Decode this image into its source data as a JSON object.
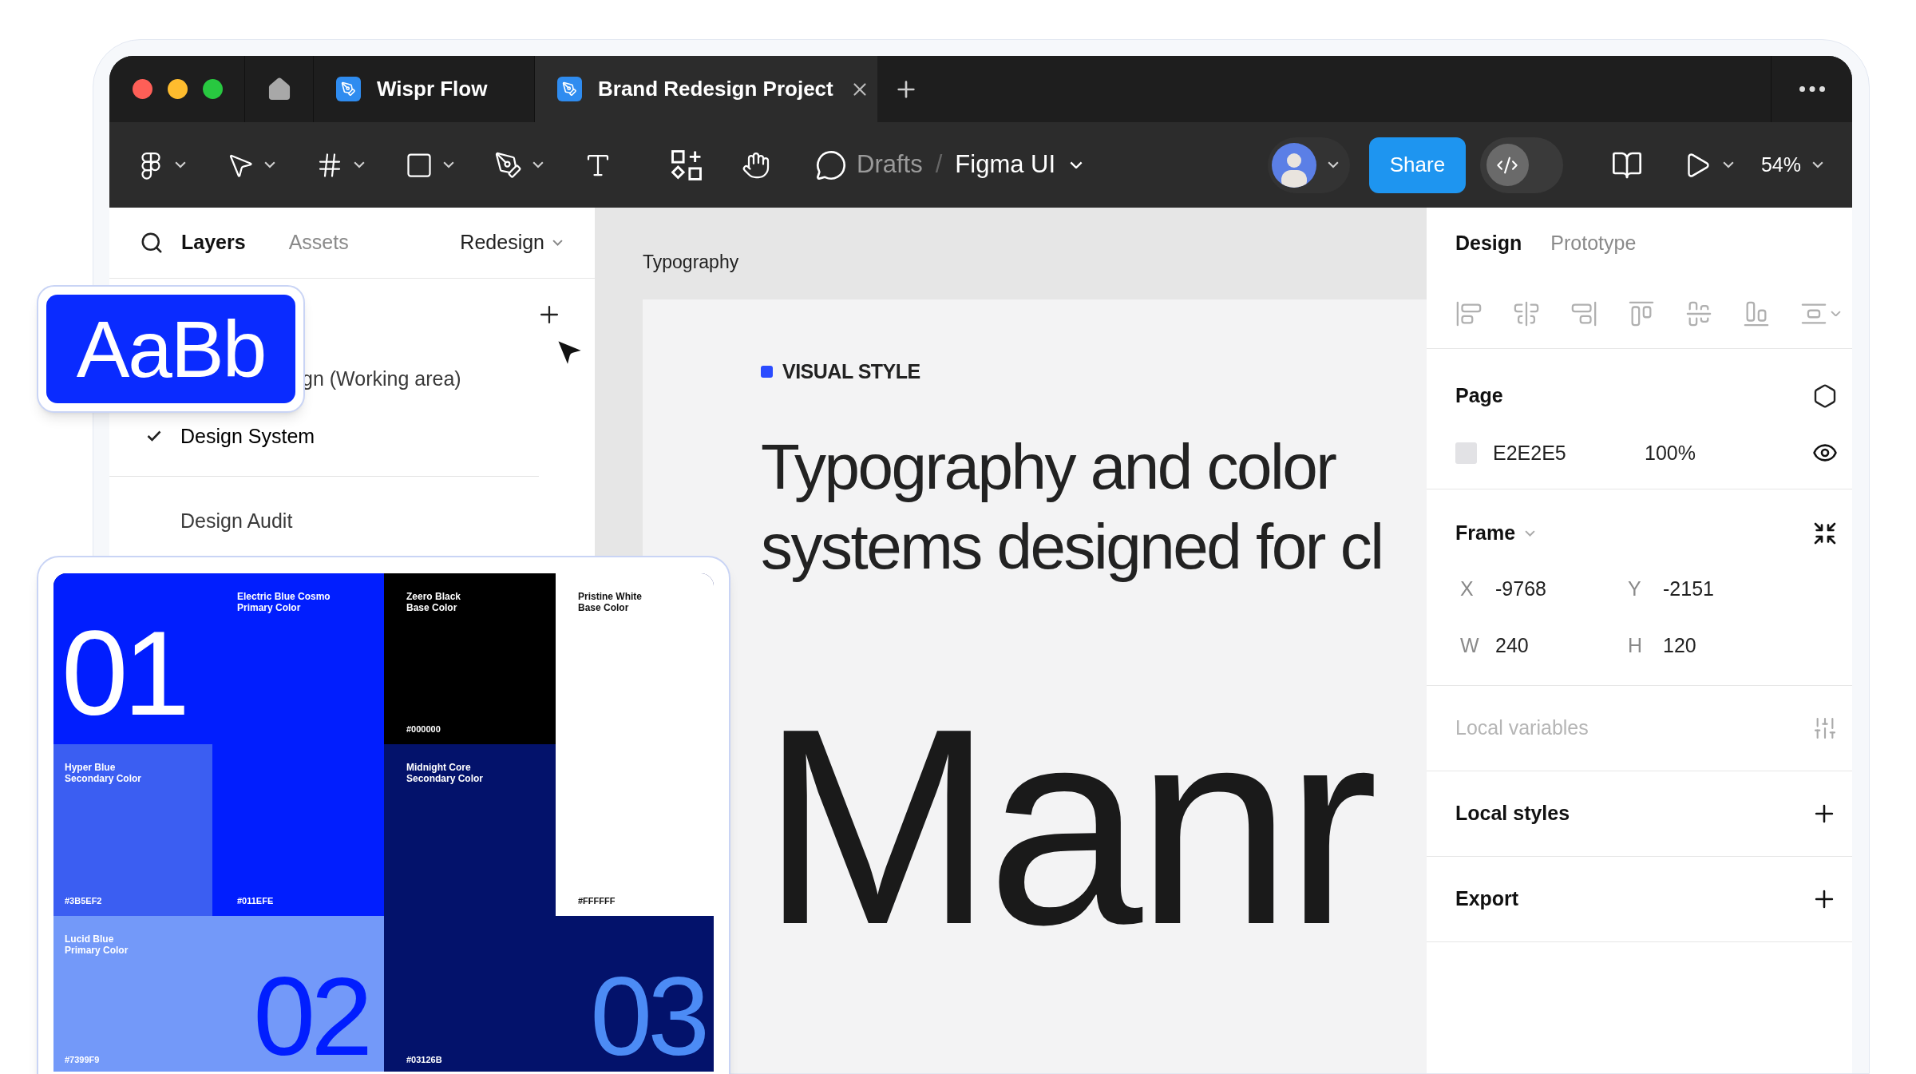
{
  "window": {
    "tabs": [
      {
        "label": "Wispr Flow",
        "selected": false
      },
      {
        "label": "Brand Redesign Project",
        "selected": true
      }
    ]
  },
  "toolbar": {
    "folder": "Drafts",
    "separator": "/",
    "file": "Figma UI",
    "share": "Share",
    "dev_mode_on": false,
    "zoom": "54%"
  },
  "layers_panel": {
    "tabs": [
      {
        "label": "Layers",
        "selected": true
      },
      {
        "label": "Assets",
        "selected": false
      }
    ],
    "page_menu": "Redesign",
    "pages": [
      {
        "label": "gn (Working area)",
        "selected": false
      },
      {
        "label": "Design System",
        "selected": true
      },
      {
        "label": "Design Audit",
        "selected": false
      }
    ]
  },
  "canvas": {
    "frame_label": "Typography",
    "eyebrow": "VISUAL STYLE",
    "headline": [
      "Typography and color",
      "systems designed for cl"
    ],
    "specimen": "Manr"
  },
  "design_panel": {
    "tabs": [
      {
        "label": "Design",
        "selected": true
      },
      {
        "label": "Prototype",
        "selected": false
      }
    ],
    "page": {
      "title": "Page",
      "fill": "E2E2E5",
      "opacity": "100%"
    },
    "frame": {
      "title": "Frame",
      "fields": [
        {
          "label": "X",
          "value": "-9768"
        },
        {
          "label": "Y",
          "value": "-2151"
        },
        {
          "label": "W",
          "value": "240"
        },
        {
          "label": "H",
          "value": "120"
        }
      ]
    },
    "sections": [
      {
        "title": "Local variables",
        "kind": "variables",
        "disabled": true
      },
      {
        "title": "Local styles",
        "kind": "add",
        "disabled": false
      },
      {
        "title": "Export",
        "kind": "add",
        "disabled": false
      }
    ]
  },
  "type_card": {
    "sample": "AaBb"
  },
  "palette": {
    "swatches": [
      {
        "name": "Electric Blue Cosmo",
        "role": "Primary Color",
        "hex": "#011EFE",
        "number": {
          "text": "01",
          "color": "#ffffff"
        },
        "color": "#011efe"
      },
      {
        "name": "Zeero Black",
        "role": "Base Color",
        "hex": "#000000",
        "color": "#000000"
      },
      {
        "name": "Hyper Blue",
        "role": "Secondary Color",
        "hex": "#3B5EF2",
        "color": "#3b5ef2"
      },
      {
        "name": "Midnight Core",
        "role": "Secondary Color",
        "hex": "#03126B",
        "number": {
          "text": "03",
          "color": "#4c8bf5"
        },
        "color": "#03126b"
      },
      {
        "name": "Pristine White",
        "role": "Base Color",
        "hex": "#FFFFFF",
        "color": "#ffffff"
      },
      {
        "name": "Lucid Blue",
        "role": "Primary Color",
        "hex": "#7399F9",
        "number": {
          "text": "02",
          "color": "#011efe"
        },
        "color": "#7399f9"
      }
    ]
  }
}
